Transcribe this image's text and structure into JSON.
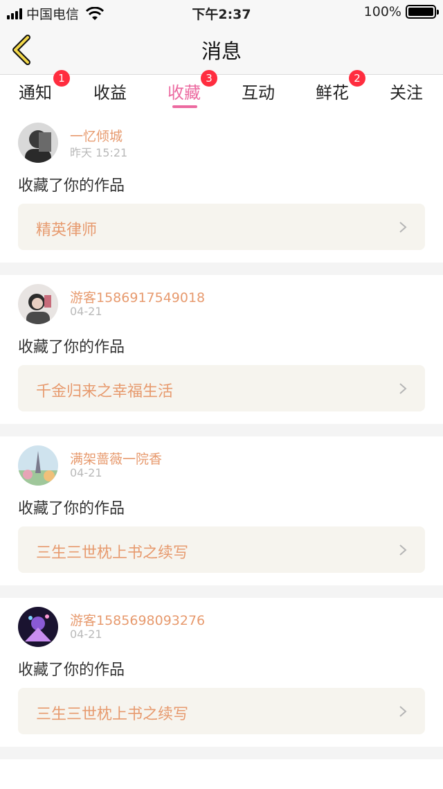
{
  "status": {
    "carrier": "中国电信",
    "time": "下午2:37",
    "battery": "100%"
  },
  "nav": {
    "title": "消息"
  },
  "tabs": [
    {
      "label": "通知",
      "badge": "1"
    },
    {
      "label": "收益",
      "badge": ""
    },
    {
      "label": "收藏",
      "badge": "3"
    },
    {
      "label": "互动",
      "badge": ""
    },
    {
      "label": "鲜花",
      "badge": "2"
    },
    {
      "label": "关注",
      "badge": ""
    }
  ],
  "active_tab": "收藏",
  "messages": [
    {
      "user": "一忆倾城",
      "date": "昨天 15:21",
      "action": "收藏了你的作品",
      "work": "精英律师"
    },
    {
      "user": "游客1586917549018",
      "date": "04-21",
      "action": "收藏了你的作品",
      "work": "千金归来之幸福生活"
    },
    {
      "user": "满架蔷薇一院香",
      "date": "04-21",
      "action": "收藏了你的作品",
      "work": "三生三世枕上书之续写"
    },
    {
      "user": "游客1585698093276",
      "date": "04-21",
      "action": "收藏了你的作品",
      "work": "三生三世枕上书之续写"
    }
  ],
  "colors": {
    "accent": "#ec6aa0",
    "username": "#e79a6e",
    "badge": "#ff2d3f",
    "back_arrow": "#f3d84a"
  }
}
